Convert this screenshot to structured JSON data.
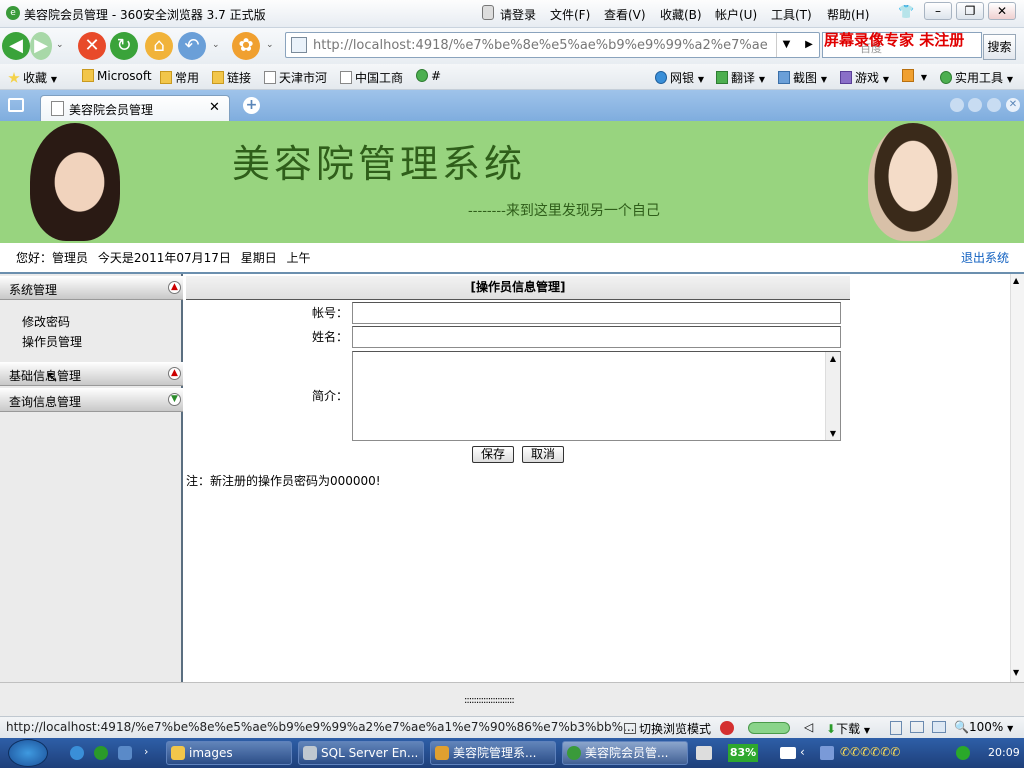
{
  "browser": {
    "title": "美容院会员管理 - 360安全浏览器 3.7 正式版",
    "login": "请登录",
    "menus": [
      "文件(F)",
      "查看(V)",
      "收藏(B)",
      "帐户(U)",
      "工具(T)",
      "帮助(H)"
    ],
    "url": "http://localhost:4918/%e7%be%8e%e5%ae%b9%e9%99%a2%e7%ae",
    "search_placeholder": "百度",
    "search_button": "搜索",
    "watermark": "屏幕录像专家  未注册",
    "favorites": [
      "收藏",
      "Microsoft",
      "常用",
      "链接",
      "天津市河",
      "中国工商",
      "#"
    ],
    "right_tools": [
      "网银",
      "翻译",
      "截图",
      "游戏",
      "实用工具"
    ],
    "tab_title": "美容院会员管理"
  },
  "banner": {
    "title": "美容院管理系统",
    "subtitle": "--------来到这里发现另一个自己"
  },
  "greeting": "您好：管理员   今天是2011年07月17日   星期日   上午",
  "logout": "退出系统",
  "sidebar": {
    "groups": [
      {
        "label": "系统管理",
        "items": [
          "修改密码",
          "操作员管理"
        ]
      },
      {
        "label": "基础信息管理",
        "items": []
      },
      {
        "label": "查询信息管理",
        "items": []
      }
    ]
  },
  "form": {
    "header": "[操作员信息管理]",
    "account_label": "帐号：",
    "name_label": "姓名：",
    "intro_label": "简介：",
    "save": "保存",
    "cancel": "取消",
    "note": "注：新注册的操作员密码为000000!"
  },
  "splitter": ":::::::::::::::::::::",
  "status": {
    "url": "http://localhost:4918/%e7%be%8e%e5%ae%b9%e9%99%a2%e7%ae%a1%e7%90%86%e7%b3%bb%...",
    "mode": "切换浏览模式",
    "download": "下载",
    "zoom": "100%"
  },
  "taskbar": {
    "items": [
      "images",
      "SQL Server En...",
      "美容院管理系...",
      "美容院会员管..."
    ],
    "battery": "83%",
    "clock": "20:09"
  }
}
